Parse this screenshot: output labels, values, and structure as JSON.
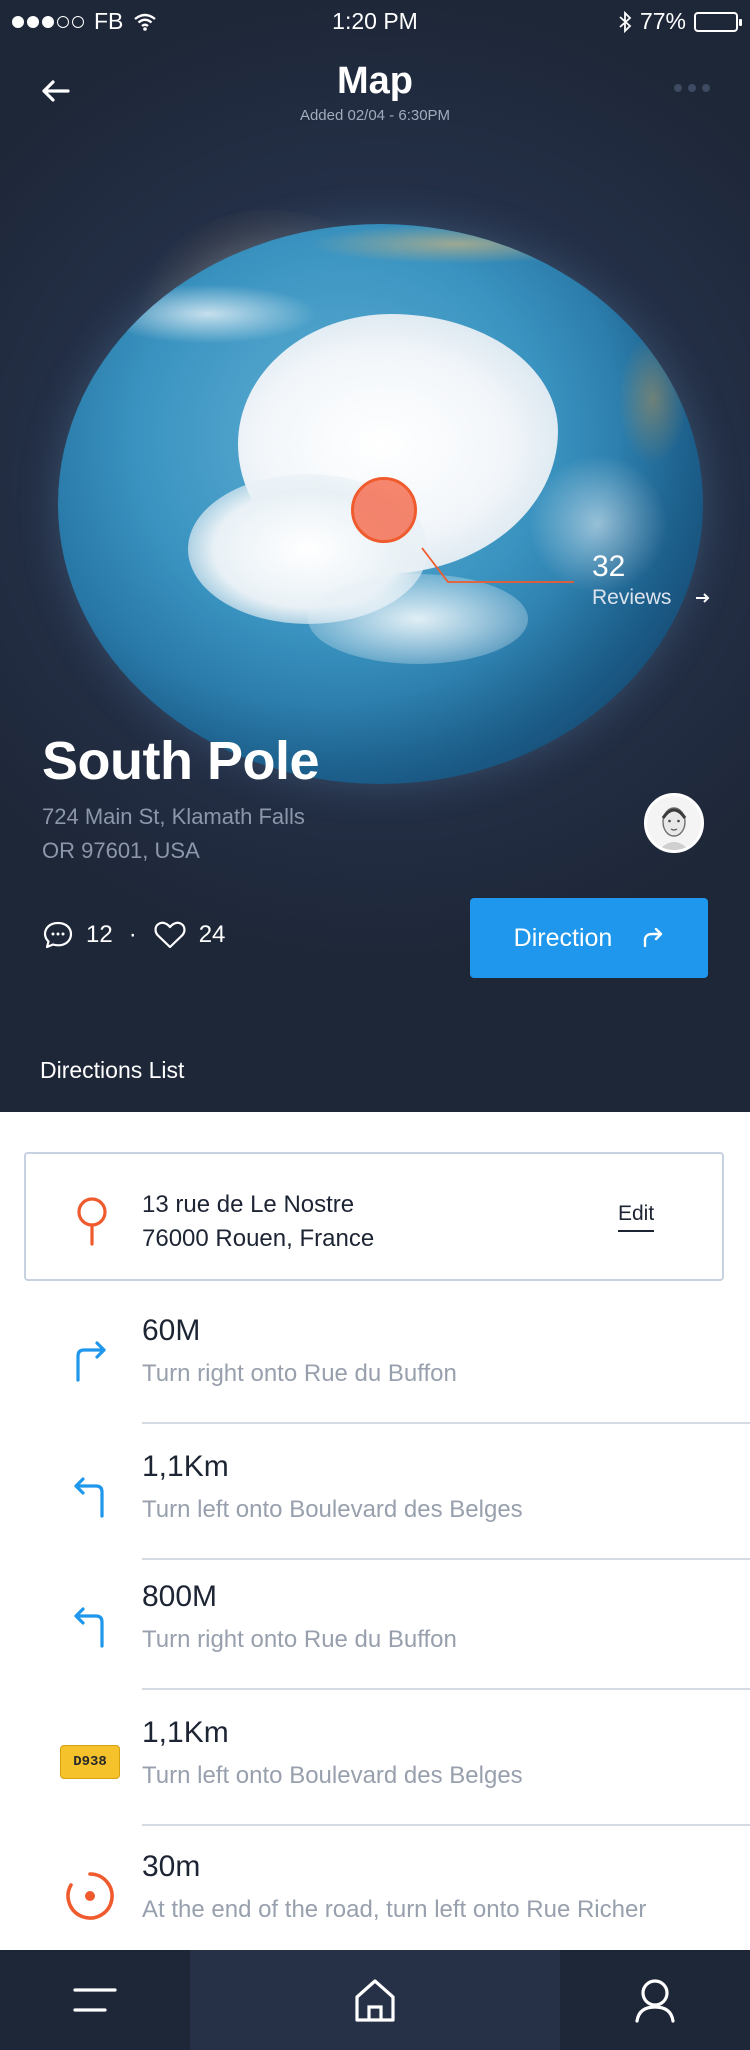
{
  "status": {
    "carrier": "FB",
    "time": "1:20 PM",
    "battery": "77%",
    "battery_level": 0.77
  },
  "nav": {
    "title": "Map",
    "subtitle": "Added 02/04 - 6:30PM"
  },
  "globe": {
    "reviews_count": "32",
    "reviews_label": "Reviews"
  },
  "place": {
    "name": "South Pole",
    "address_line1": "724 Main St, Klamath Falls",
    "address_line2": "OR 97601, USA"
  },
  "stats": {
    "comments": "12",
    "separator": "·",
    "likes": "24"
  },
  "direction_button": {
    "label": "Direction"
  },
  "directions_list": {
    "label": "Directions List",
    "start": {
      "line1": "13 rue de Le Nostre",
      "line2": "76000 Rouen, France",
      "edit_label": "Edit"
    },
    "steps": [
      {
        "distance": "60M",
        "instruction": "Turn right onto Rue du Buffon",
        "icon": "turn-right-icon"
      },
      {
        "distance": "1,1Km",
        "instruction": "Turn left onto Boulevard des Belges",
        "icon": "turn-left-icon"
      },
      {
        "distance": "800M",
        "instruction": "Turn right onto Rue du Buffon",
        "icon": "turn-left-icon"
      },
      {
        "distance": "1,1Km",
        "instruction": "Turn left onto Boulevard des Belges",
        "icon": "road-sign-icon",
        "road": "D938"
      },
      {
        "distance": "30m",
        "instruction": "At the end of the road, turn left onto Rue Richer",
        "icon": "destination-icon"
      }
    ]
  },
  "colors": {
    "accent_blue": "#1e97ec",
    "accent_orange": "#f05b2e",
    "dark_bg": "#1e2738"
  }
}
